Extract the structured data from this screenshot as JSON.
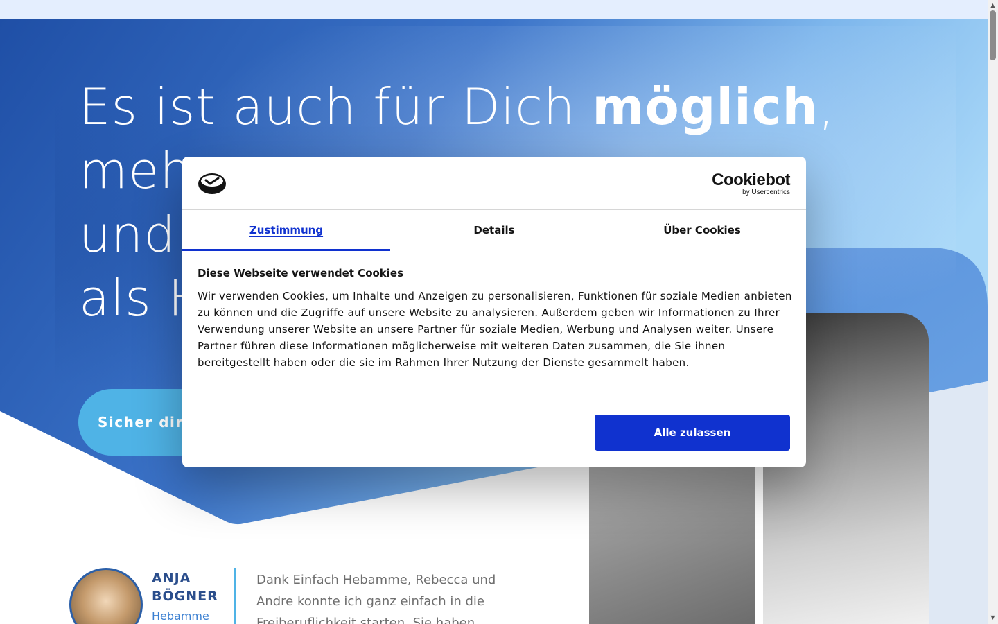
{
  "colors": {
    "hero_dark": "#2456a9",
    "hero_light": "#9fd2f6",
    "cta": "#4fb3e6",
    "accent_blue": "#1032cf",
    "name_blue": "#2b4e8c"
  },
  "hero": {
    "headline": {
      "line1_a": "Es ist auch für Dich ",
      "line1_b": "möglich",
      "line1_c": ",",
      "line2_a": "meh",
      "line3_a": "und",
      "line4_a": "als H"
    },
    "cta_label": "Sicher dir"
  },
  "testimonial": {
    "name": "ANJA BÖGNER",
    "role": "Hebamme",
    "quote": "Dank Einfach Hebamme, Rebecca und Andre konnte ich ganz einfach in die Freiberuflichkeit starten. Sie haben"
  },
  "cookie_dialog": {
    "brand": "Cookiebot",
    "brand_sub": "by Usercentrics",
    "tabs": [
      "Zustimmung",
      "Details",
      "Über Cookies"
    ],
    "active_tab": "Zustimmung",
    "title": "Diese Webseite verwendet Cookies",
    "text": "Wir verwenden Cookies, um Inhalte und Anzeigen zu personalisieren, Funktionen für soziale Medien anbieten zu können und die Zugriffe auf unsere Website zu analysieren. Außerdem geben wir Informationen zu Ihrer Verwendung unserer Website an unsere Partner für soziale Medien, Werbung und Analysen weiter. Unsere Partner führen diese Informationen möglicherweise mit weiteren Daten zusammen, die Sie ihnen bereitgestellt haben oder die sie im Rahmen Ihrer Nutzung der Dienste gesammelt haben.",
    "allow_all_label": "Alle zulassen"
  },
  "icons": {
    "dialog_logo": "cookie-check-icon",
    "scroll_up": "chevron-up-icon",
    "scroll_down": "chevron-down-icon"
  }
}
